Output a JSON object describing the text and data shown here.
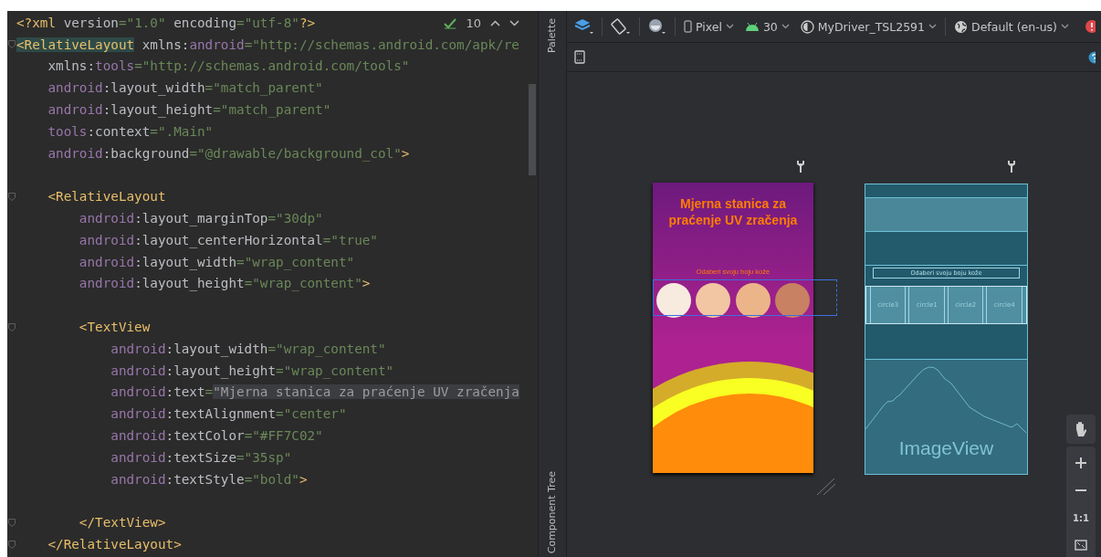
{
  "editor": {
    "inspection_count": "10",
    "lines": [
      {
        "fold": false,
        "tokens": [
          {
            "kind": "tag",
            "text": "<?xml"
          },
          {
            "kind": "attr",
            "text": " version"
          },
          {
            "kind": "value",
            "text": "=\"1.0\""
          },
          {
            "kind": "attr",
            "text": " encoding"
          },
          {
            "kind": "value",
            "text": "=\"utf-8\""
          },
          {
            "kind": "tag",
            "text": "?>"
          }
        ]
      },
      {
        "fold": true,
        "tokens": [
          {
            "kind": "tag_match",
            "text": "<RelativeLayout"
          },
          {
            "kind": "attr",
            "text": " xmlns:"
          },
          {
            "kind": "ns",
            "text": "android"
          },
          {
            "kind": "value",
            "text": "=\"http://schemas.android.com/apk/re"
          }
        ]
      },
      {
        "fold": false,
        "tokens": [
          {
            "kind": "attr",
            "text": "    xmlns:"
          },
          {
            "kind": "ns",
            "text": "tools"
          },
          {
            "kind": "value",
            "text": "=\"http://schemas.android.com/tools\""
          }
        ]
      },
      {
        "fold": false,
        "tokens": [
          {
            "kind": "ns",
            "text": "    android"
          },
          {
            "kind": "attr",
            "text": ":layout_width"
          },
          {
            "kind": "value",
            "text": "=\"match_parent\""
          }
        ]
      },
      {
        "fold": false,
        "tokens": [
          {
            "kind": "ns",
            "text": "    android"
          },
          {
            "kind": "attr",
            "text": ":layout_height"
          },
          {
            "kind": "value",
            "text": "=\"match_parent\""
          }
        ]
      },
      {
        "fold": false,
        "tokens": [
          {
            "kind": "ns",
            "text": "    tools"
          },
          {
            "kind": "attr",
            "text": ":context"
          },
          {
            "kind": "value",
            "text": "=\".Main\""
          }
        ]
      },
      {
        "fold": false,
        "tokens": [
          {
            "kind": "ns",
            "text": "    android"
          },
          {
            "kind": "attr",
            "text": ":background"
          },
          {
            "kind": "value",
            "text": "=\"@drawable/background_col\""
          },
          {
            "kind": "tag",
            "text": ">"
          }
        ]
      },
      {
        "fold": false
      },
      {
        "fold": true,
        "tokens": [
          {
            "kind": "tag",
            "text": "    <RelativeLayout"
          }
        ]
      },
      {
        "fold": false,
        "tokens": [
          {
            "kind": "ns",
            "text": "        android"
          },
          {
            "kind": "attr",
            "text": ":layout_marginTop"
          },
          {
            "kind": "value",
            "text": "=\"30dp\""
          }
        ]
      },
      {
        "fold": false,
        "tokens": [
          {
            "kind": "ns",
            "text": "        android"
          },
          {
            "kind": "attr",
            "text": ":layout_centerHorizontal"
          },
          {
            "kind": "value",
            "text": "=\"true\""
          }
        ]
      },
      {
        "fold": false,
        "tokens": [
          {
            "kind": "ns",
            "text": "        android"
          },
          {
            "kind": "attr",
            "text": ":layout_width"
          },
          {
            "kind": "value",
            "text": "=\"wrap_content\""
          }
        ]
      },
      {
        "fold": false,
        "tokens": [
          {
            "kind": "ns",
            "text": "        android"
          },
          {
            "kind": "attr",
            "text": ":layout_height"
          },
          {
            "kind": "value",
            "text": "=\"wrap_content\""
          },
          {
            "kind": "tag",
            "text": ">"
          }
        ]
      },
      {
        "fold": false
      },
      {
        "fold": true,
        "tokens": [
          {
            "kind": "tag",
            "text": "        <TextView"
          }
        ]
      },
      {
        "fold": false,
        "tokens": [
          {
            "kind": "ns",
            "text": "            android"
          },
          {
            "kind": "attr",
            "text": ":layout_width"
          },
          {
            "kind": "value",
            "text": "=\"wrap_content\""
          }
        ]
      },
      {
        "fold": false,
        "tokens": [
          {
            "kind": "ns",
            "text": "            android"
          },
          {
            "kind": "attr",
            "text": ":layout_height"
          },
          {
            "kind": "value",
            "text": "=\"wrap_content\""
          }
        ]
      },
      {
        "fold": false,
        "tokens": [
          {
            "kind": "ns",
            "text": "            android"
          },
          {
            "kind": "attr",
            "text": ":text"
          },
          {
            "kind": "value",
            "text": "="
          },
          {
            "kind": "value_selected",
            "text": "\"Mjerna stanica za praćenje UV zračenja"
          }
        ]
      },
      {
        "fold": false,
        "tokens": [
          {
            "kind": "ns",
            "text": "            android"
          },
          {
            "kind": "attr",
            "text": ":textAlignment"
          },
          {
            "kind": "value",
            "text": "=\"center\""
          }
        ]
      },
      {
        "fold": false,
        "tokens": [
          {
            "kind": "ns",
            "text": "            android"
          },
          {
            "kind": "attr",
            "text": ":textColor"
          },
          {
            "kind": "value",
            "text": "=\"#FF7C02\""
          }
        ]
      },
      {
        "fold": false,
        "tokens": [
          {
            "kind": "ns",
            "text": "            android"
          },
          {
            "kind": "attr",
            "text": ":textSize"
          },
          {
            "kind": "value",
            "text": "=\"35sp\""
          }
        ]
      },
      {
        "fold": false,
        "tokens": [
          {
            "kind": "ns",
            "text": "            android"
          },
          {
            "kind": "attr",
            "text": ":textStyle"
          },
          {
            "kind": "value",
            "text": "=\"bold\""
          },
          {
            "kind": "tag",
            "text": ">"
          }
        ]
      },
      {
        "fold": false
      },
      {
        "fold": true,
        "tokens": [
          {
            "kind": "tag",
            "text": "        </TextView>"
          }
        ]
      },
      {
        "fold": true,
        "tokens": [
          {
            "kind": "tag",
            "text": "    </RelativeLayout>"
          }
        ]
      }
    ]
  },
  "side_strip": {
    "tabs": [
      {
        "label": "Palette"
      },
      {
        "label": "Component Tree"
      }
    ]
  },
  "toolbar": {
    "device": "Pixel",
    "api": "30",
    "theme": "MyDriver_TSL2591",
    "locale": "Default (en-us)"
  },
  "preview": {
    "title": "Mjerna stanica za praćenje UV zračenja",
    "subtitle": "Odaberi svoju boju kože",
    "swatches": [
      {
        "color": "#f7ebe0"
      },
      {
        "color": "#f2c6a3"
      },
      {
        "color": "#ecb589"
      },
      {
        "color": "#c98163"
      }
    ]
  },
  "blueprint": {
    "subtitle": "Odaberi svoju boju kože",
    "swatches": [
      {
        "label": "circle3"
      },
      {
        "label": "circle1"
      },
      {
        "label": "circle2"
      },
      {
        "label": "circle4"
      }
    ],
    "image_label": "ImageView"
  },
  "zoom_controls": {
    "actual_size": "1:1"
  }
}
